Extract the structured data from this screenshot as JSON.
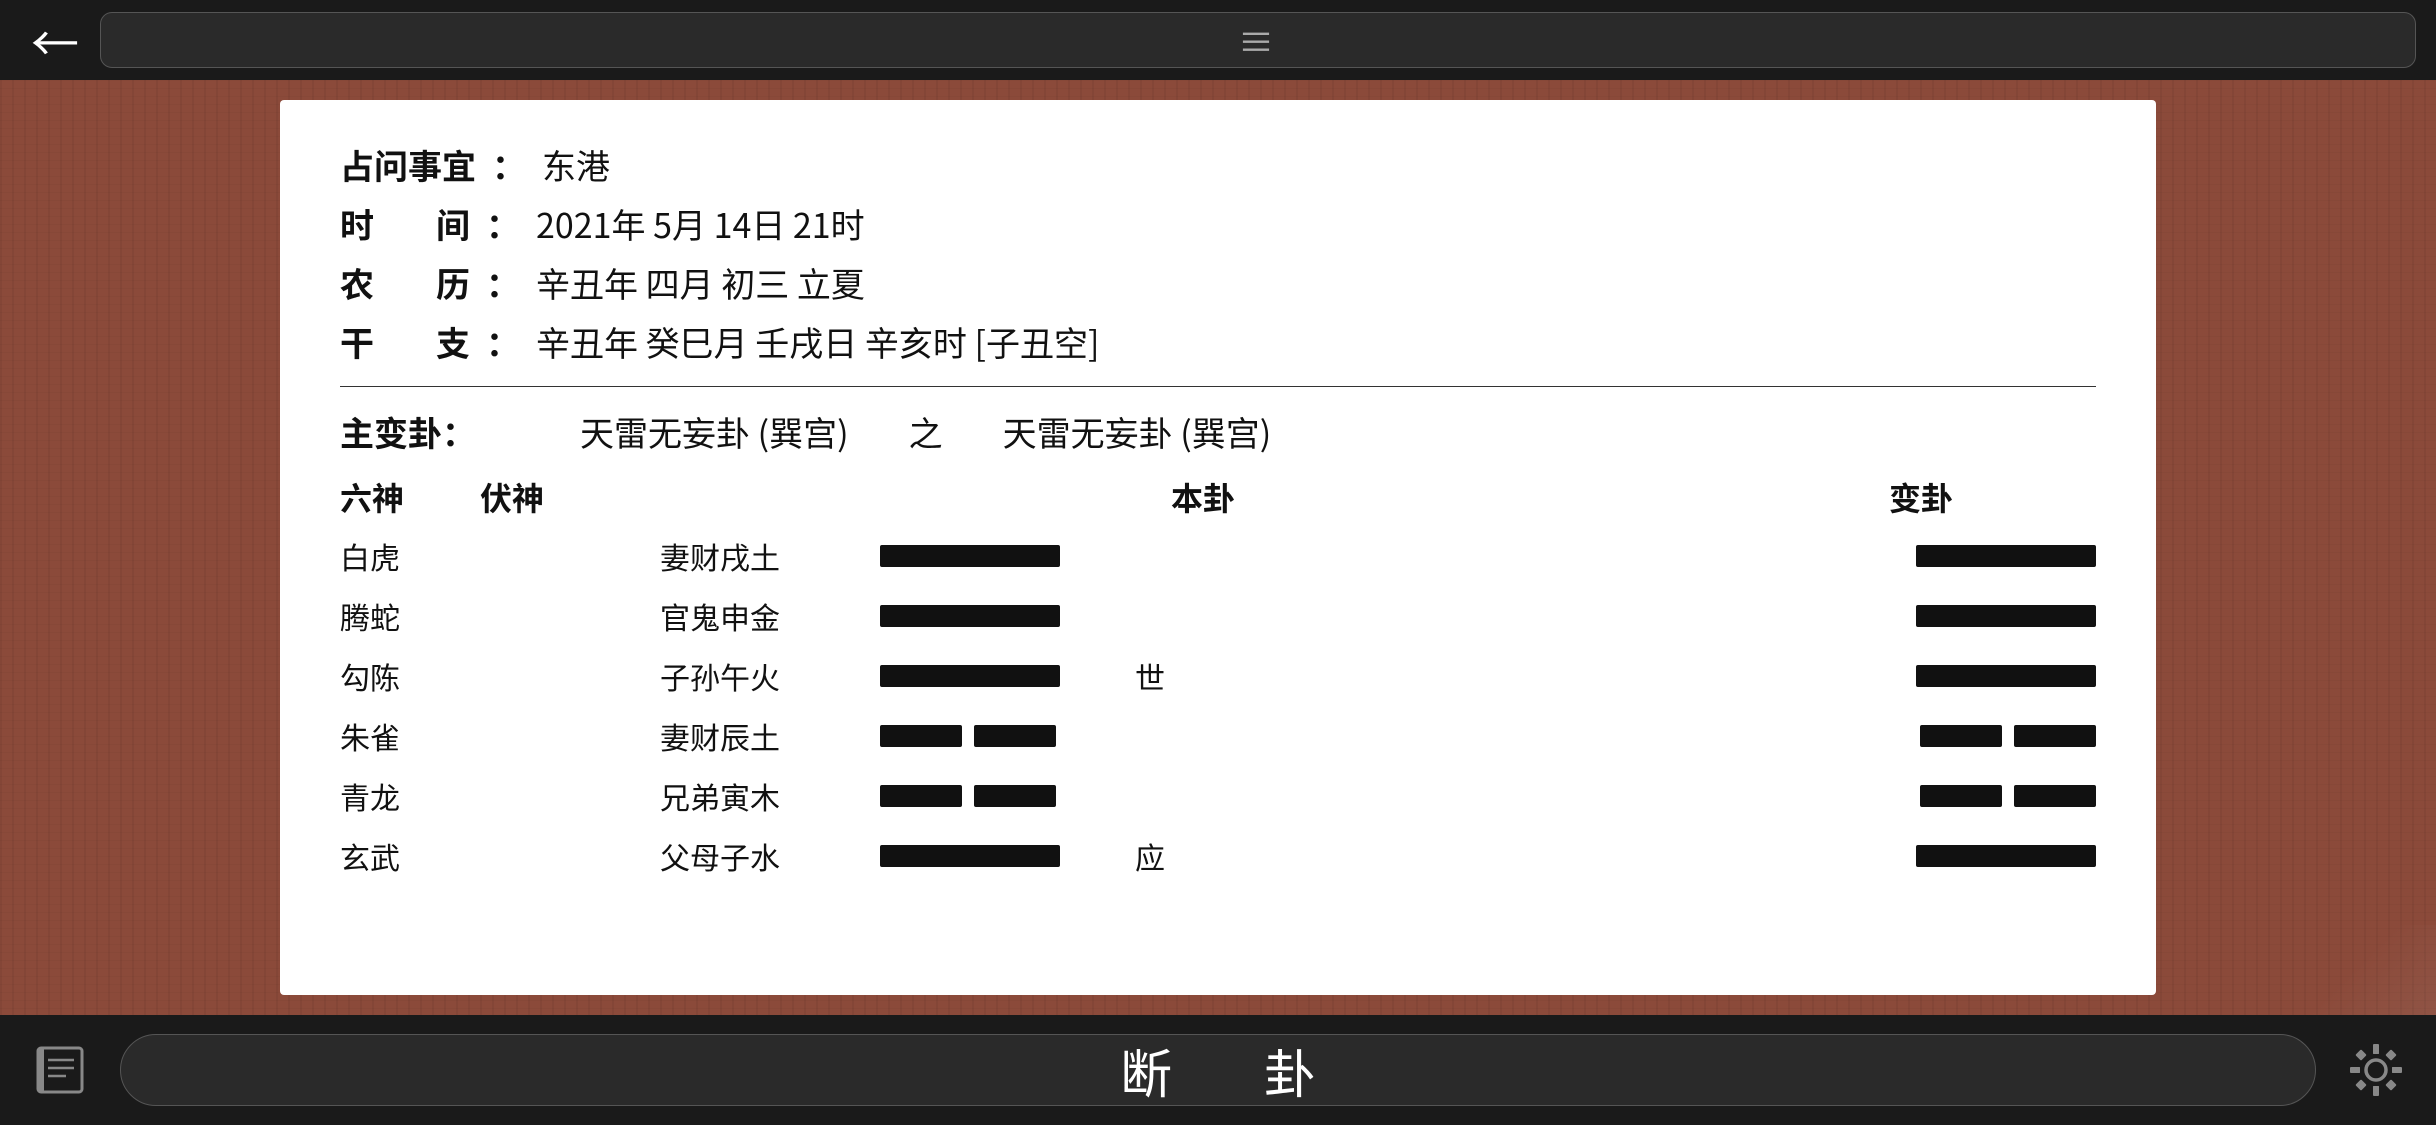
{
  "topBar": {
    "backLabel": "←",
    "hamburger": "≡"
  },
  "info": {
    "subject_label": "占问事宜",
    "subject_value": "东港",
    "time_label": "时  间",
    "time_value": "2021年 5月 14日 21时",
    "lunar_label": "农  历",
    "lunar_value": "辛丑年 四月 初三 立夏",
    "ganzhi_label": "干  支",
    "ganzhi_value": "辛丑年 癸巳月 壬戌日 辛亥时 [子丑空]"
  },
  "hexagram": {
    "master_label": "主变卦：",
    "bengua_name": "天雷无妄卦 (巽宫)",
    "zhi": "之",
    "biangua_name": "天雷无妄卦 (巽宫)",
    "header": {
      "liushen": "六神",
      "fushen": "伏神",
      "bengua": "本卦",
      "biangua": "变卦"
    },
    "rows": [
      {
        "liushen": "白虎",
        "fushen": "",
        "yaoName": "妻财戌土",
        "bengua": "solid",
        "marker": "",
        "biangua": "solid"
      },
      {
        "liushen": "腾蛇",
        "fushen": "",
        "yaoName": "官鬼申金",
        "bengua": "solid",
        "marker": "",
        "biangua": "solid"
      },
      {
        "liushen": "勾陈",
        "fushen": "",
        "yaoName": "子孙午火",
        "bengua": "solid",
        "marker": "世",
        "biangua": "solid"
      },
      {
        "liushen": "朱雀",
        "fushen": "",
        "yaoName": "妻财辰土",
        "bengua": "broken",
        "marker": "",
        "biangua": "broken"
      },
      {
        "liushen": "青龙",
        "fushen": "",
        "yaoName": "兄弟寅木",
        "bengua": "broken",
        "marker": "",
        "biangua": "broken"
      },
      {
        "liushen": "玄武",
        "fushen": "",
        "yaoName": "父母子水",
        "bengua": "solid",
        "marker": "应",
        "biangua": "solid"
      }
    ]
  },
  "bottomBar": {
    "centerText": "断    卦"
  }
}
